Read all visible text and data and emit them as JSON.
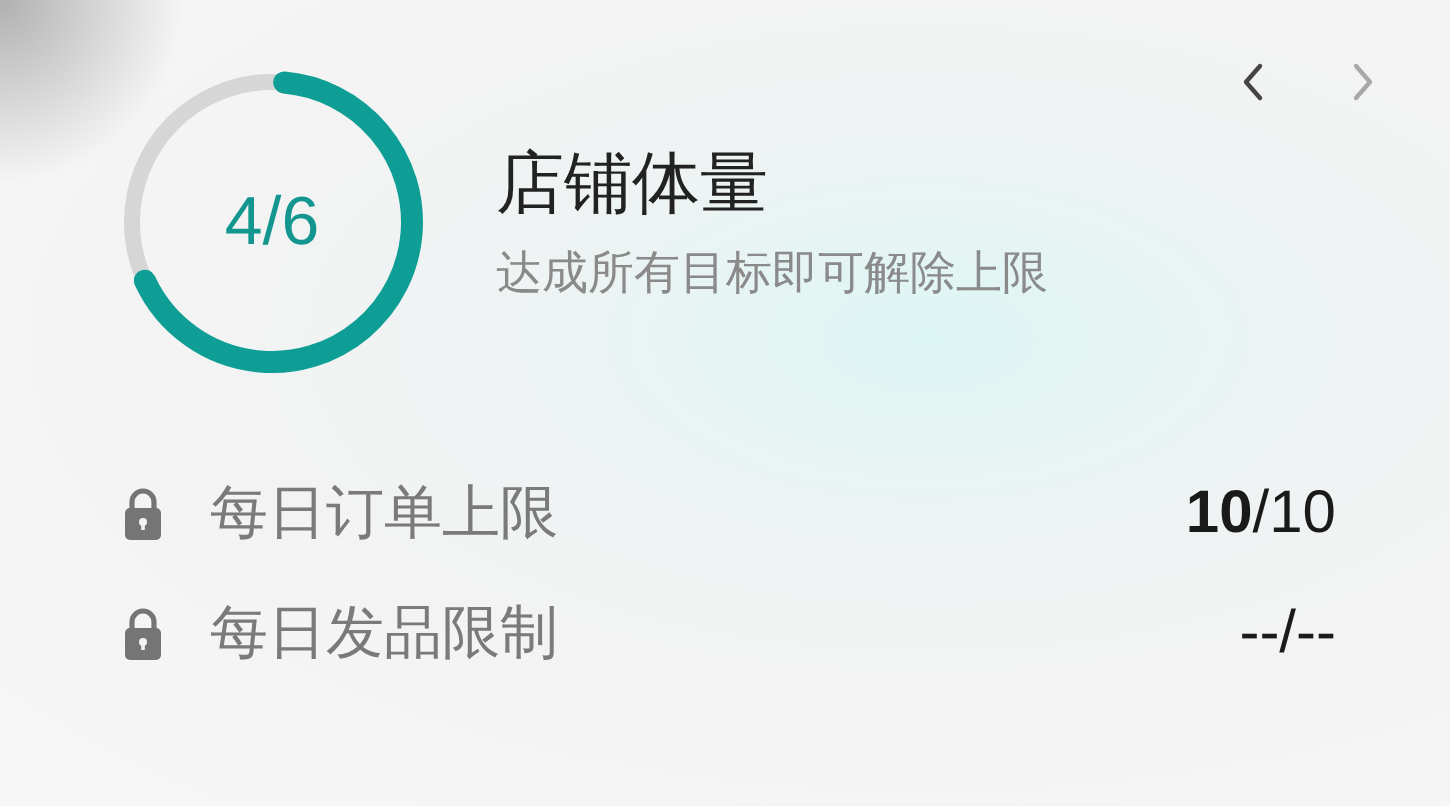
{
  "progress": {
    "label": "4/6",
    "level": 0.667
  },
  "title": "店铺体量",
  "subtitle": "达成所有目标即可解除上限",
  "nav": [
    {
      "kind": "prev",
      "disabled": false
    },
    {
      "kind": "next",
      "disabled": true
    }
  ],
  "limits": [
    {
      "label": "每日订单上限",
      "locked": true,
      "value": "**10**/10"
    },
    {
      "label": "每日发品限制",
      "locked": true,
      "value": "--/--"
    }
  ]
}
